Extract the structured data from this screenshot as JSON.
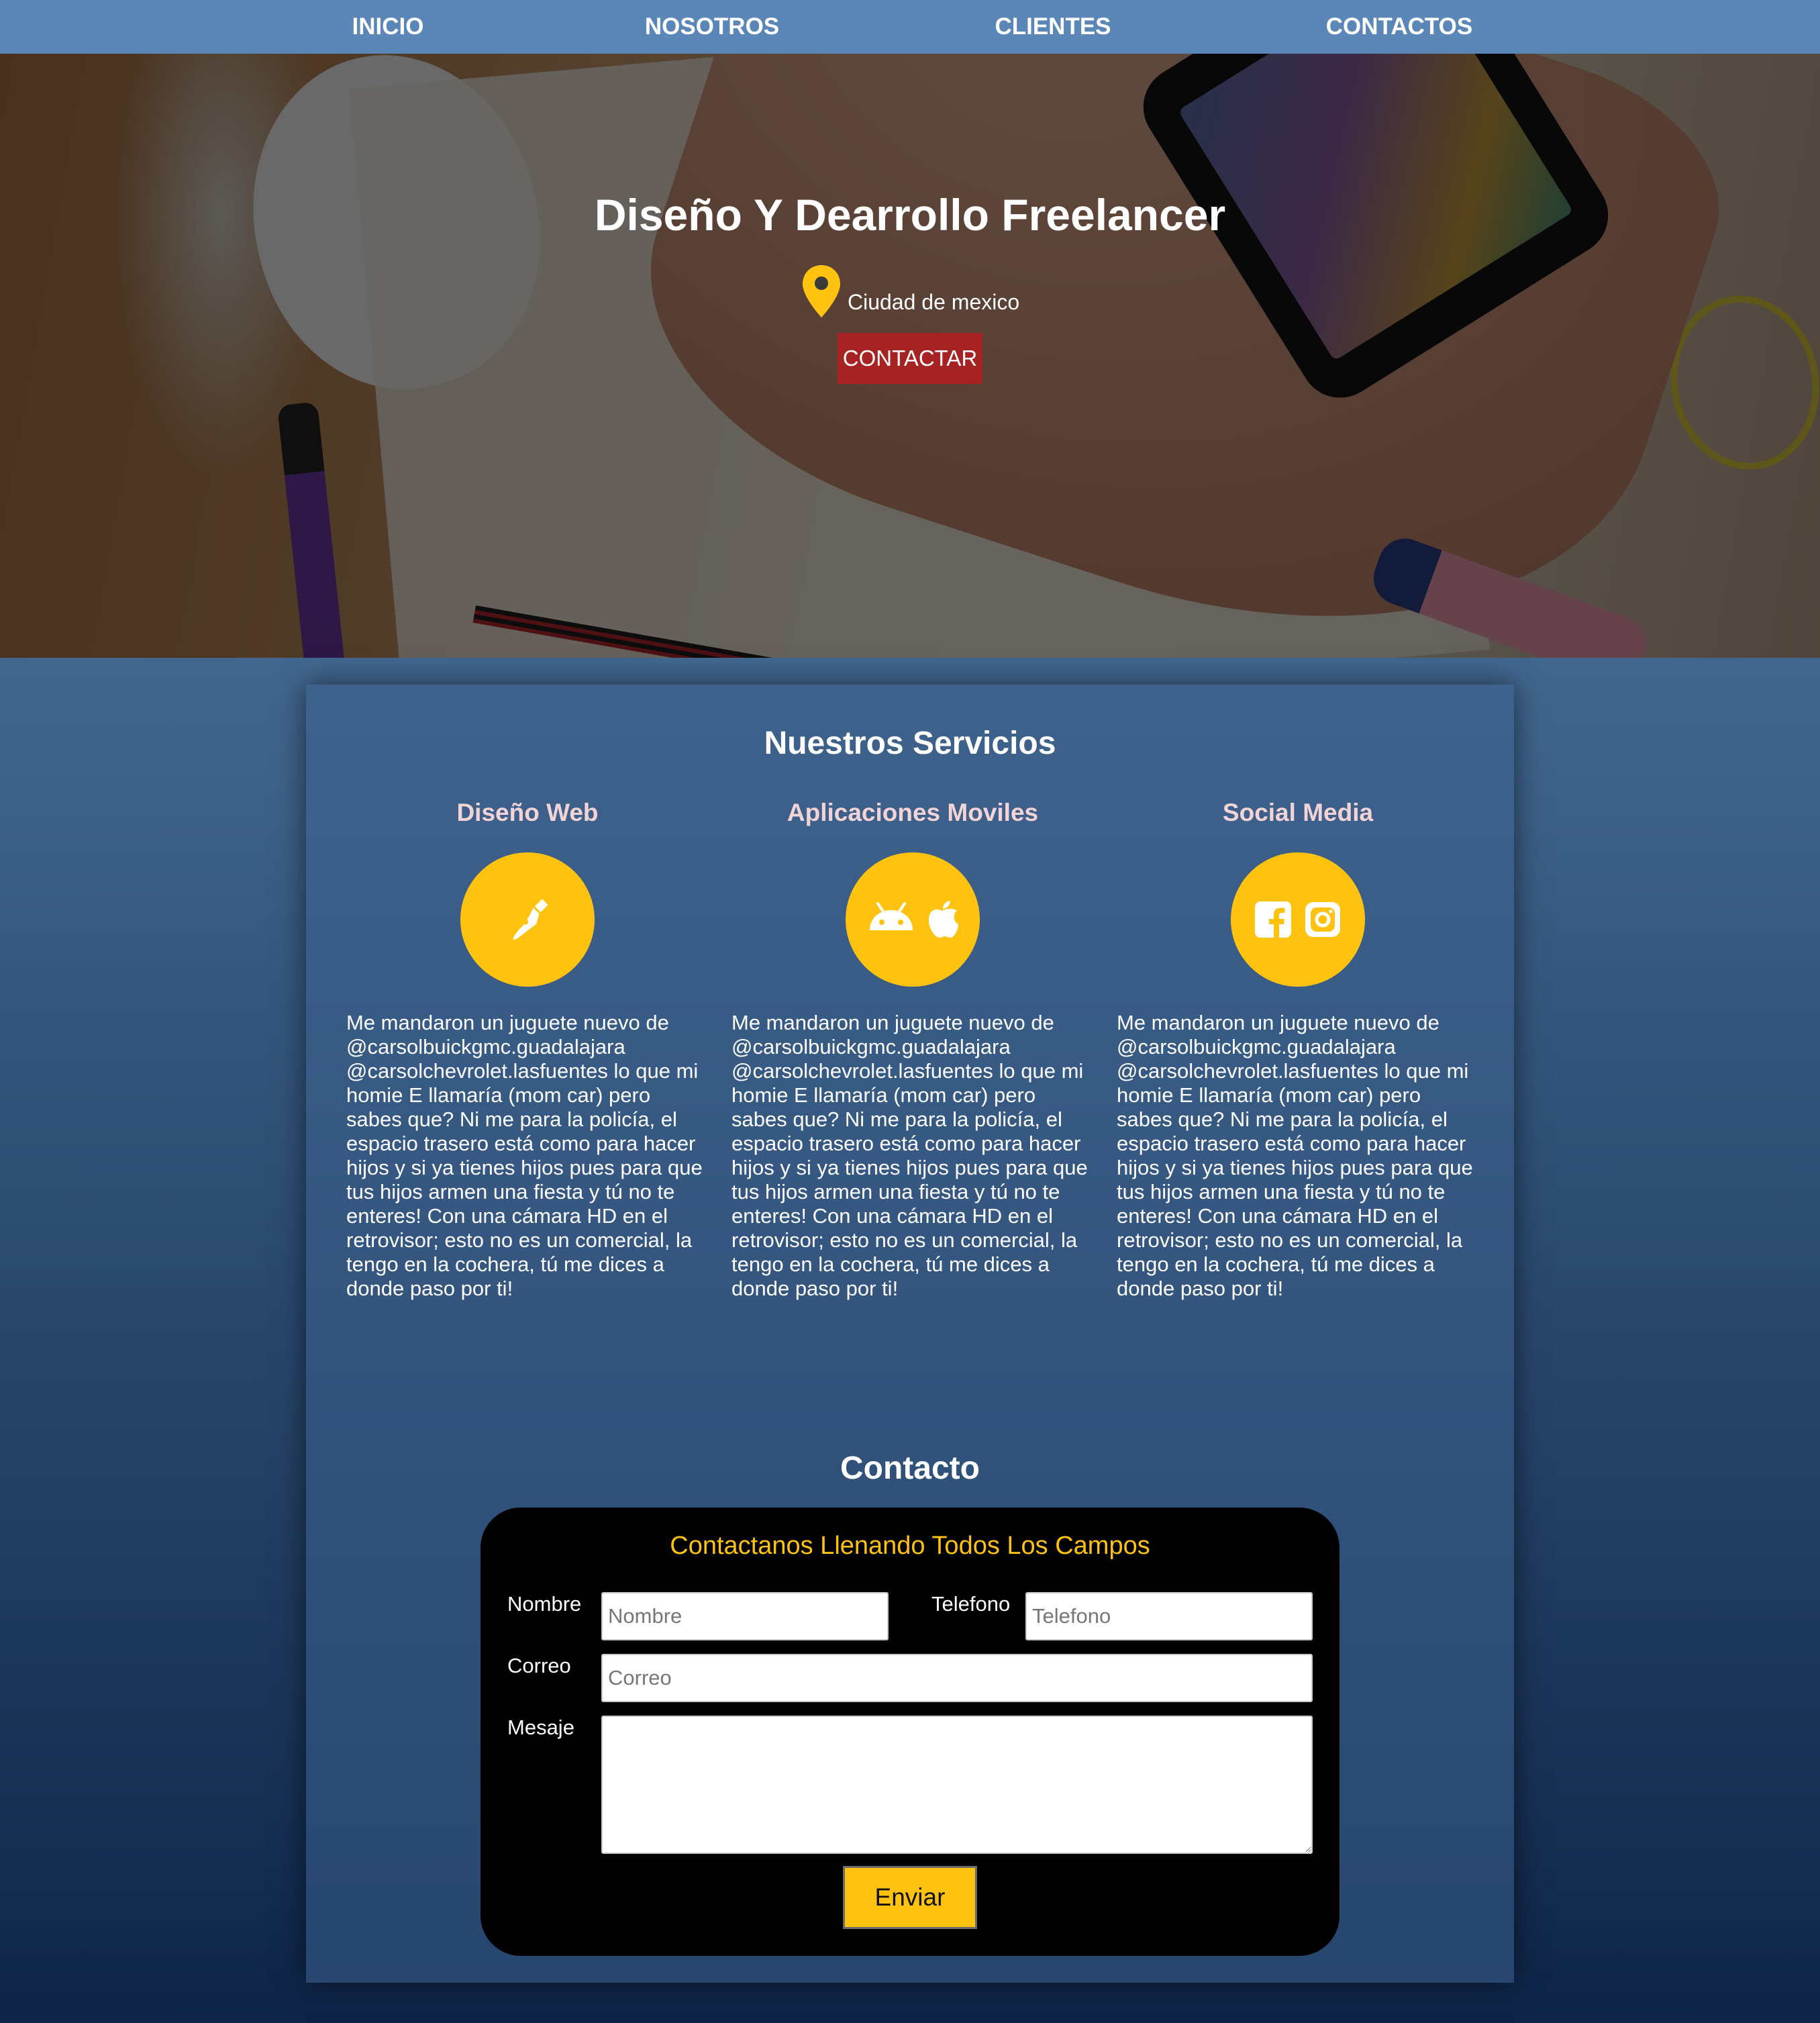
{
  "nav": {
    "items": [
      {
        "label": "INICIO"
      },
      {
        "label": "NOSOTROS"
      },
      {
        "label": "CLIENTES"
      },
      {
        "label": "CONTACTOS"
      }
    ]
  },
  "hero": {
    "title": "Diseño Y Dearrollo Freelancer",
    "location_icon": "map-pin-icon",
    "location": "Ciudad de mexico",
    "button_label": "CONTACTAR"
  },
  "services": {
    "title": "Nuestros Servicios",
    "items": [
      {
        "title": "Diseño Web",
        "icons": [
          "pen-nib-icon"
        ],
        "text": "Me mandaron un juguete nuevo de @carsolbuickgmc.guadalajara @carsolchevrolet.lasfuentes lo que mi homie E llamaría (mom car) pero sabes que? Ni me para la policía, el espacio trasero está como para hacer hijos y si ya tienes hijos pues para que tus hijos armen una fiesta y tú no te enteres! Con una cámara HD en el retrovisor; esto no es un comercial, la tengo en la cochera, tú me dices a donde paso por ti!"
      },
      {
        "title": "Aplicaciones Moviles",
        "icons": [
          "android-icon",
          "apple-icon"
        ],
        "text": "Me mandaron un juguete nuevo de @carsolbuickgmc.guadalajara @carsolchevrolet.lasfuentes lo que mi homie E llamaría (mom car) pero sabes que? Ni me para la policía, el espacio trasero está como para hacer hijos y si ya tienes hijos pues para que tus hijos armen una fiesta y tú no te enteres! Con una cámara HD en el retrovisor; esto no es un comercial, la tengo en la cochera, tú me dices a donde paso por ti!"
      },
      {
        "title": "Social Media",
        "icons": [
          "facebook-icon",
          "instagram-icon"
        ],
        "text": "Me mandaron un juguete nuevo de @carsolbuickgmc.guadalajara @carsolchevrolet.lasfuentes lo que mi homie E llamaría (mom car) pero sabes que? Ni me para la policía, el espacio trasero está como para hacer hijos y si ya tienes hijos pues para que tus hijos armen una fiesta y tú no te enteres! Con una cámara HD en el retrovisor; esto no es un comercial, la tengo en la cochera, tú me dices a donde paso por ti!"
      }
    ]
  },
  "contact": {
    "title": "Contacto",
    "form_heading": "Contactanos Llenando Todos Los Campos",
    "fields": {
      "nombre": {
        "label": "Nombre",
        "placeholder": "Nombre",
        "value": ""
      },
      "telefono": {
        "label": "Telefono",
        "placeholder": "Telefono",
        "value": ""
      },
      "correo": {
        "label": "Correo",
        "placeholder": "Correo",
        "value": ""
      },
      "mensaje": {
        "label": "Mesaje",
        "placeholder": "",
        "value": ""
      }
    },
    "submit_label": "Enviar"
  },
  "colors": {
    "nav_bg": "#5a87b7",
    "accent_yellow": "#ffc20e",
    "button_red": "#a72222",
    "service_title": "#f2d3d6",
    "form_bg": "#000000"
  }
}
